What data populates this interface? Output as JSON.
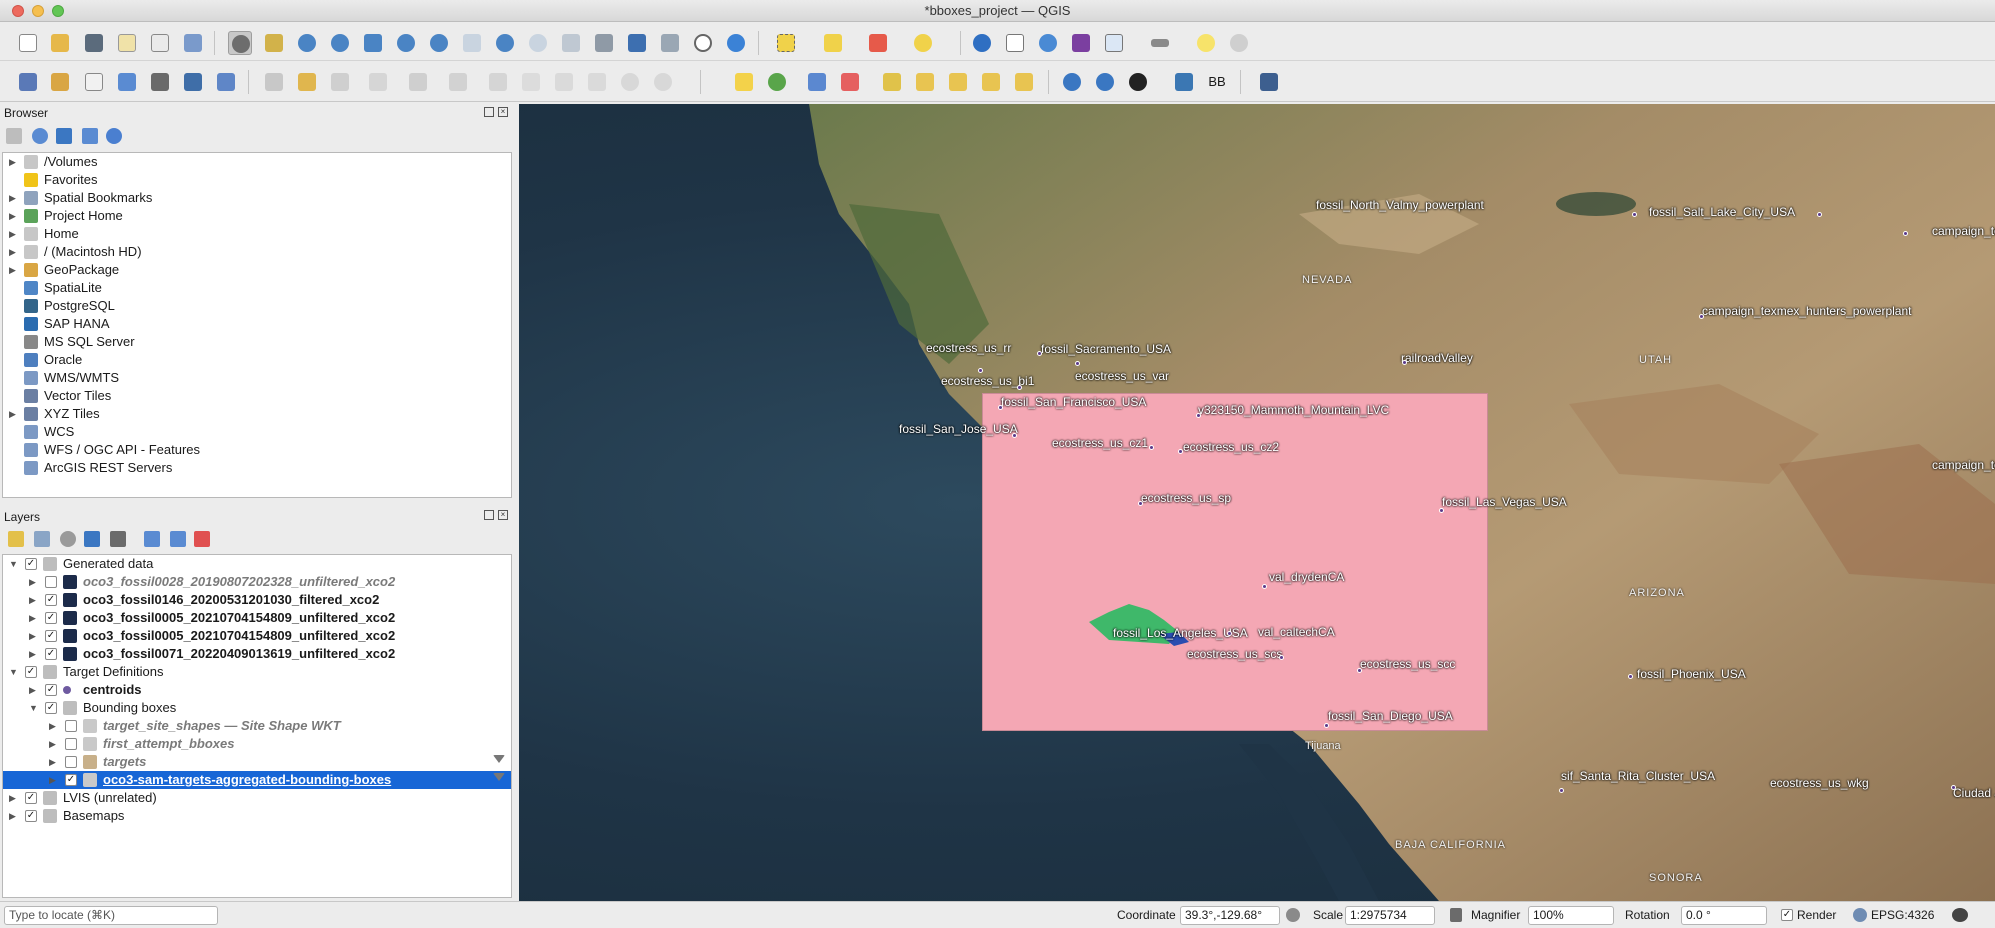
{
  "window": {
    "title": "*bboxes_project — QGIS"
  },
  "browser": {
    "title": "Browser",
    "items": [
      {
        "label": "/Volumes",
        "icon": "folder-icon",
        "has_children": true
      },
      {
        "label": "Favorites",
        "icon": "star-icon",
        "has_children": false
      },
      {
        "label": "Spatial Bookmarks",
        "icon": "bookmark-icon",
        "has_children": true
      },
      {
        "label": "Project Home",
        "icon": "project-home-icon",
        "has_children": true
      },
      {
        "label": "Home",
        "icon": "folder-icon",
        "has_children": true
      },
      {
        "label": "/ (Macintosh HD)",
        "icon": "folder-icon",
        "has_children": true
      },
      {
        "label": "GeoPackage",
        "icon": "geopackage-icon",
        "has_children": true
      },
      {
        "label": "SpatiaLite",
        "icon": "spatialite-icon",
        "has_children": false
      },
      {
        "label": "PostgreSQL",
        "icon": "postgresql-icon",
        "has_children": false
      },
      {
        "label": "SAP HANA",
        "icon": "sap-hana-icon",
        "has_children": false
      },
      {
        "label": "MS SQL Server",
        "icon": "mssql-icon",
        "has_children": false
      },
      {
        "label": "Oracle",
        "icon": "oracle-icon",
        "has_children": false
      },
      {
        "label": "WMS/WMTS",
        "icon": "globe-icon",
        "has_children": false
      },
      {
        "label": "Vector Tiles",
        "icon": "grid-icon",
        "has_children": false
      },
      {
        "label": "XYZ Tiles",
        "icon": "grid-icon",
        "has_children": true
      },
      {
        "label": "WCS",
        "icon": "globe-icon",
        "has_children": false
      },
      {
        "label": "WFS / OGC API - Features",
        "icon": "globe-icon",
        "has_children": false
      },
      {
        "label": "ArcGIS REST Servers",
        "icon": "globe-icon",
        "has_children": false
      }
    ]
  },
  "layers": {
    "title": "Layers",
    "items": [
      {
        "label": "Generated data",
        "checked": true,
        "expanded": true,
        "style": "normal",
        "icon": "group-icon"
      },
      {
        "label": "oco3_fossil0028_20190807202328_unfiltered_xco2",
        "checked": false,
        "expanded": false,
        "style": "italic",
        "icon": "raster-icon"
      },
      {
        "label": "oco3_fossil0146_20200531201030_filtered_xco2",
        "checked": true,
        "expanded": false,
        "style": "bold",
        "icon": "raster-icon"
      },
      {
        "label": "oco3_fossil0005_20210704154809_unfiltered_xco2",
        "checked": true,
        "expanded": false,
        "style": "bold",
        "icon": "raster-icon"
      },
      {
        "label": "oco3_fossil0005_20210704154809_unfiltered_xco2",
        "checked": true,
        "expanded": false,
        "style": "bold",
        "icon": "raster-icon"
      },
      {
        "label": "oco3_fossil0071_20220409013619_unfiltered_xco2",
        "checked": true,
        "expanded": false,
        "style": "bold",
        "icon": "raster-icon"
      },
      {
        "label": "Target Definitions",
        "checked": true,
        "expanded": true,
        "style": "normal",
        "icon": "group-icon"
      },
      {
        "label": "centroids",
        "checked": true,
        "expanded": false,
        "style": "bold",
        "icon": "point-layer-icon"
      },
      {
        "label": "Bounding boxes",
        "checked": true,
        "expanded": true,
        "style": "normal",
        "icon": "group-icon"
      },
      {
        "label": "target_site_shapes — Site Shape WKT",
        "checked": false,
        "expanded": false,
        "style": "italic",
        "icon": "polygon-layer-icon"
      },
      {
        "label": "first_attempt_bboxes",
        "checked": false,
        "expanded": false,
        "style": "italic",
        "icon": "polygon-layer-icon"
      },
      {
        "label": "targets",
        "checked": false,
        "expanded": false,
        "style": "italic",
        "icon": "table-layer-icon"
      },
      {
        "label": "oco3-sam-targets-aggregated-bounding-boxes",
        "checked": true,
        "expanded": false,
        "style": "selected",
        "icon": "polygon-layer-icon"
      },
      {
        "label": "LVIS (unrelated)",
        "checked": true,
        "expanded": false,
        "style": "normal",
        "icon": "group-icon"
      },
      {
        "label": "Basemaps",
        "checked": true,
        "expanded": false,
        "style": "normal",
        "icon": "group-icon"
      }
    ]
  },
  "map": {
    "labels": [
      "fossil_North_Valmy_powerplant",
      "fossil_Salt_Lake_City_USA",
      "campaign_tex",
      "campaign_texmex_hunters_powerplant",
      "railroadValley",
      "ecostress_us_rr",
      "fossil_Sacramento_USA",
      "ecostress_us_bi1",
      "ecostress_us_var",
      "fossil_San_Francisco_USA",
      "v323150_Mammoth_Mountain_LVC",
      "fossil_San_Jose_USA",
      "ecostress_us_cz1",
      "ecostress_us_cz2",
      "ecostress_us_sp",
      "fossil_Las_Vegas_USA",
      "campaign_texmex_san",
      "val_drydenCA",
      "fossil_Los_Angeles_USA",
      "val_caltechCA",
      "ecostress_us_scs",
      "ecostress_us_scc",
      "fossil_Phoenix_USA",
      "fossil_San_Diego_USA",
      "sif_Santa_Rita_Cluster_USA",
      "ecostress_us_wkg",
      "Ciudad Juárez"
    ],
    "regions": [
      "NEVADA",
      "UTAH",
      "ARIZONA",
      "BAJA CALIFORNIA",
      "SONORA",
      "Tijuana"
    ]
  },
  "statusbar": {
    "locate_placeholder": "Type to locate (⌘K)",
    "coordinate_label": "Coordinate",
    "coordinate_value": "39.3°,-129.68°",
    "scale_label": "Scale",
    "scale_value": "1:2975734",
    "magnifier_label": "Magnifier",
    "magnifier_value": "100%",
    "rotation_label": "Rotation",
    "rotation_value": "0.0 °",
    "render_label": "Render",
    "render_checked": true,
    "crs_label": "EPSG:4326"
  },
  "toolbar": {
    "bb_label": "BB"
  },
  "colors": {
    "selection": "#1766d6",
    "bbox_fill": "#f4a7b4",
    "point": "#5b3a8a"
  }
}
